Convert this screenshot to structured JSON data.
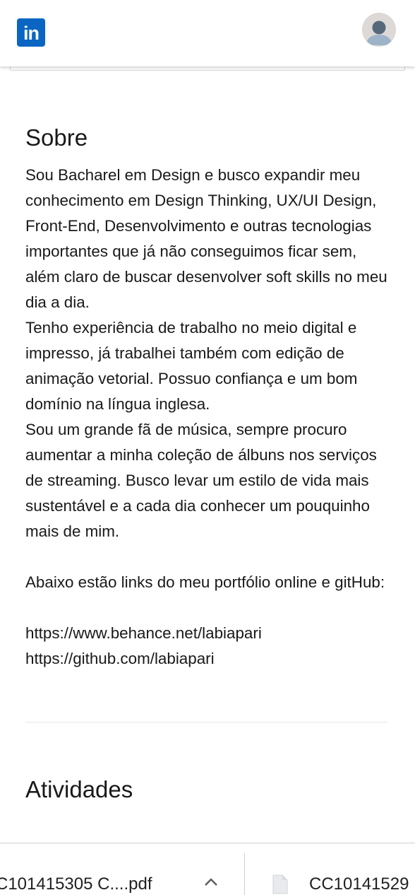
{
  "header": {
    "logo_text": "in",
    "logo_icon": "linkedin-logo-icon",
    "avatar_icon": "user-avatar-icon",
    "brand_color": "#0a66c2"
  },
  "about": {
    "title": "Sobre",
    "text": "Sou Bacharel em Design e busco expandir meu conhecimento em Design Thinking, UX/UI Design, Front-End, Desenvolvimento e outras tecnologias importantes que já não conseguimos ficar sem, além claro de buscar desenvolver soft skills no meu dia a dia.\nTenho experiência de trabalho no meio digital e impresso, já trabalhei também com edição de animação vetorial. Possuo confiança e um bom domínio na língua inglesa.\nSou um grande fã de música, sempre procuro aumentar a minha coleção de álbuns nos serviços de streaming. Busco levar um estilo de vida mais sustentável e a cada dia conhecer um pouquinho mais de mim.\n\nAbaixo estão links do meu portfólio online e gitHub:\n\nhttps://www.behance.net/labiapari\nhttps://github.com/labiapari"
  },
  "activities": {
    "title": "Atividades"
  },
  "downloads_bar": {
    "items": [
      {
        "label": "C101415305 C....pdf",
        "icon": "chevron-up-icon"
      },
      {
        "label": "CC10141529",
        "icon": "file-icon"
      }
    ]
  }
}
